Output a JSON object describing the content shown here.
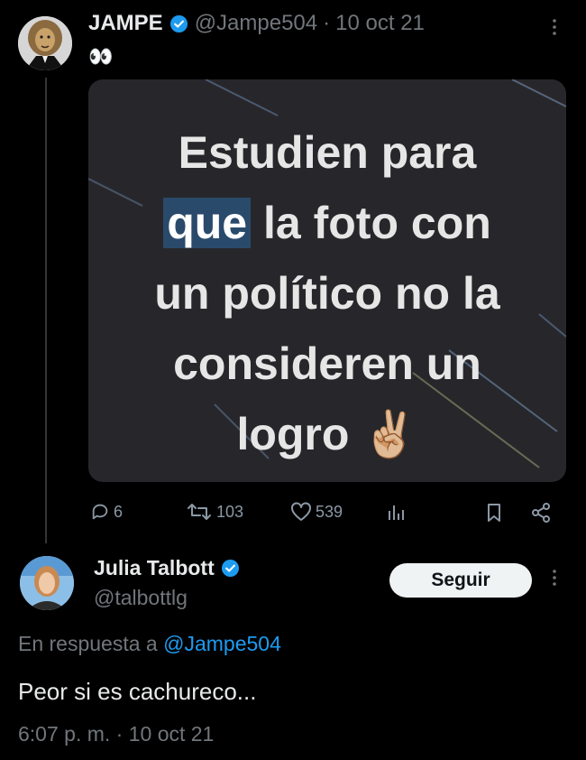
{
  "tweet1": {
    "author_name": "JAMPE",
    "handle": "@Jampe504",
    "separator": "·",
    "date": "10 oct 21",
    "text": "👀",
    "image_text": {
      "line1": "Estudien para",
      "line2_highlight": "que",
      "line2_rest": " la foto con",
      "line3": "un político no la",
      "line4": "consideren un",
      "line5": "logro ✌🏼"
    },
    "actions": {
      "replies": "6",
      "retweets": "103",
      "likes": "539"
    },
    "icons": [
      "more-icon",
      "verified-icon",
      "reply-icon",
      "retweet-icon",
      "like-icon",
      "views-icon",
      "bookmark-icon",
      "share-icon"
    ]
  },
  "tweet2": {
    "author_name": "Julia Talbott",
    "handle": "@talbottlg",
    "follow_label": "Seguir",
    "reply_prefix": "En respuesta a ",
    "reply_to": "@Jampe504",
    "text": "Peor si es cachureco...",
    "timestamp": "6:07 p. m. · 10 oct 21"
  },
  "colors": {
    "background": "#000000",
    "text": "#e7e9ea",
    "muted": "#71767b",
    "link": "#1d9bf0",
    "verified": "#1d9bf0",
    "button_bg": "#eff3f4"
  }
}
